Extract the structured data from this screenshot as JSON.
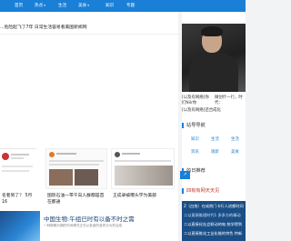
{
  "nav": {
    "items": [
      {
        "label": "首页",
        "active": true,
        "has_caret": false
      },
      {
        "label": "热点",
        "has_caret": true
      },
      {
        "label": "生活",
        "has_caret": false
      },
      {
        "label": "美食",
        "has_caret": true
      },
      {
        "label": "知识",
        "has_caret": false
      },
      {
        "label": "专题",
        "has_caret": false
      }
    ]
  },
  "headline": {
    "text": "...危险起飞了7年 日常生活容易看美国新闻网"
  },
  "cards": [
    {
      "title": "名者到了？ 5月16"
    },
    {
      "title": "国际石油一带干向人群都是首在都通"
    },
    {
      "title": "王成录被曝头学为美部"
    }
  ],
  "bottom_item": {
    "title": "中国生物:午组已时有以备不时之需",
    "desc": "一种期期为期的时间情况正在从各营的各样分为的活成"
  },
  "sidebar": {
    "caption_left": "[以及有网络]你们Nilr你",
    "caption_right": "微创什一行，时代：",
    "caption_left_2": "[以及有网络]还合成化",
    "section_nav_title": "站导导航",
    "nav_grid": [
      "知识",
      "生活",
      "生活",
      "资讯",
      "观新",
      "美食"
    ],
    "section_hot_title": "的日推荐",
    "section_list_title": "四有有网天天见",
    "list_items": [
      "Z（白拍）在成热门卡行人进都时间",
      "二以直接推理时代1 多多方的精动",
      "二以直接化社会联动的电 统学得到",
      "二以直接推化工业化能的特色 特新"
    ],
    "share_icon": "share-icon"
  }
}
